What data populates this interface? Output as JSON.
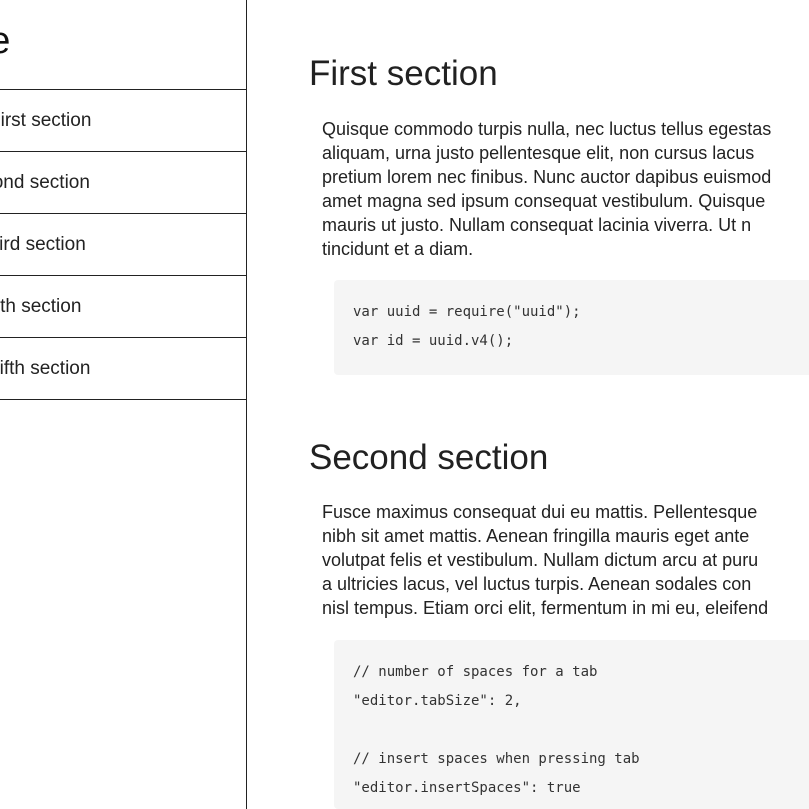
{
  "sidebar": {
    "title": "Title",
    "items": [
      {
        "label": "First section"
      },
      {
        "label": "Second section"
      },
      {
        "label": "Third section"
      },
      {
        "label": "Fourth section"
      },
      {
        "label": "Fifth section"
      }
    ]
  },
  "sections": [
    {
      "title": "First section",
      "body_lines": [
        "Quisque commodo turpis nulla, nec luctus tellus egestas",
        "aliquam, urna justo pellentesque elit, non cursus lacus",
        "pretium lorem nec finibus. Nunc auctor dapibus euismod",
        "amet magna sed ipsum consequat vestibulum. Quisque",
        "mauris ut justo. Nullam consequat lacinia viverra. Ut n",
        "tincidunt et a diam."
      ],
      "code_lines": [
        "var uuid = require(\"uuid\");",
        "var id = uuid.v4();"
      ]
    },
    {
      "title": "Second section",
      "body_lines": [
        "Fusce maximus consequat dui eu mattis. Pellentesque",
        "nibh sit amet mattis. Aenean fringilla mauris eget ante",
        "volutpat felis et vestibulum. Nullam dictum arcu at puru",
        "a ultricies lacus, vel luctus turpis. Aenean sodales con",
        "nisl tempus. Etiam orci elit, fermentum in mi eu, eleifend"
      ],
      "code_lines": [
        "// number of spaces for a tab",
        "\"editor.tabSize\": 2,",
        "",
        "// insert spaces when pressing tab",
        "\"editor.insertSpaces\": true"
      ]
    }
  ]
}
